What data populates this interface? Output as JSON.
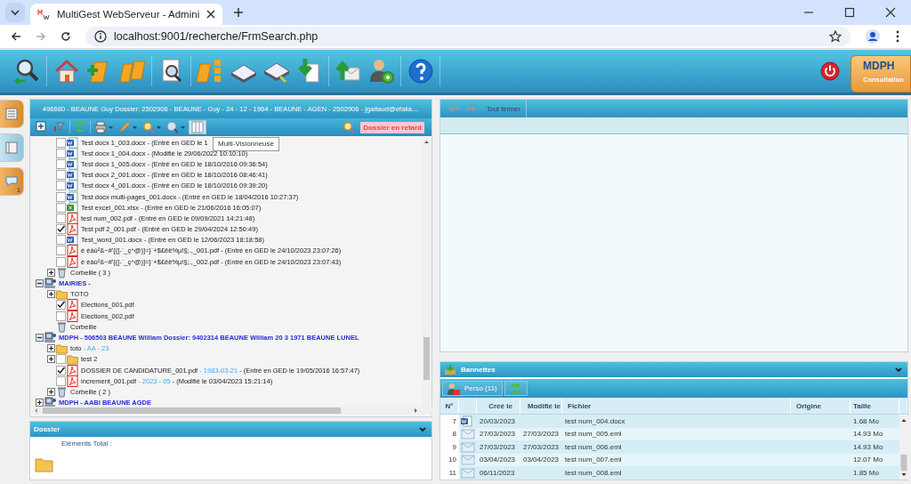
{
  "browser": {
    "tab_title": "MultiGest WebServeur - Admini",
    "url": "localhost:9001/recherche/FrmSearch.php"
  },
  "app_header": {
    "profile": {
      "title": "MDPH",
      "subtitle": "Consultation"
    }
  },
  "side_tabs": [
    {
      "selected": false
    },
    {
      "selected": true
    },
    {
      "selected": false,
      "badge": "1"
    }
  ],
  "dossier_panel": {
    "header": "496680 - BEAUNE Guy Dossier: 2502906 - BEAUNE - Guy - 24 - 12 - 1964 - BEAUNE - AGEN - 2502906 - jgaltaud@efalia....",
    "late_button": "Dossier en retard",
    "tooltip": "Multi-Visionneuse",
    "tree": [
      {
        "children": [
          {
            "kind": "word",
            "label": "Test docx 1_003.docx",
            "info": "- (Entré en GED le 1",
            "checked": false
          },
          {
            "kind": "word",
            "label": "Test docx 1_004.docx",
            "info": "- (Modifié le 29/06/2022 10:10:10)",
            "checked": false
          },
          {
            "kind": "word",
            "label": "Test docx 1_005.docx",
            "info": "- (Entré en GED le 18/10/2016 09:36:54)",
            "checked": false
          },
          {
            "kind": "word",
            "label": "Test docx 2_001.docx",
            "info": "- (Entré en GED le 18/10/2016 08:46:41)",
            "checked": false
          },
          {
            "kind": "word",
            "label": "Test docx 4_001.docx",
            "info": "- (Entré en GED le 18/10/2016 09:39:20)",
            "checked": false
          },
          {
            "kind": "word",
            "label": "Test docx multi-pages_001.docx",
            "info": "- (Entré en GED le 18/04/2016 10:27:37)",
            "checked": false
          },
          {
            "kind": "excel",
            "label": "Test excel_001.xlsx",
            "info": "- (Entré en GED le 21/06/2016 16:05:07)",
            "checked": false
          },
          {
            "kind": "pdf",
            "label": "test num_002.pdf",
            "info": "- (Entré en GED le 09/09/2021 14:21:48)",
            "checked": false
          },
          {
            "kind": "pdf",
            "label": "Test pdf 2_001.pdf",
            "info": "- (Entré en GED le 29/04/2024 12:50:49)",
            "checked": true
          },
          {
            "kind": "word",
            "label": "Test_word_001.docx",
            "info": "- (Entré en GED le 12/06/2023 18:18:58)",
            "checked": false
          },
          {
            "kind": "pdf",
            "label": "é èàù²&~#'{([-`_ç^@)]=}`+$£ëë%µ!§;.,_001.pdf",
            "info": "- (Entré en GED le 24/10/2023 23:07:26)",
            "checked": false
          },
          {
            "kind": "pdf",
            "label": "é èàù²&~#'{([-`_ç^@)]=}`+$£ëë%µ!§;.,_002.pdf",
            "info": "- (Entré en GED le 24/10/2023 23:07:43)",
            "checked": false
          },
          {
            "kind": "trash",
            "label": "Corbeille ( 3 )",
            "expanded": false
          }
        ]
      },
      {
        "kind": "group",
        "label": "MAIRIES -",
        "expanded": true,
        "children": [
          {
            "kind": "folder",
            "label": "TOTO",
            "expanded": false
          },
          {
            "kind": "pdf",
            "label": "Elections_001.pdf",
            "checked": true
          },
          {
            "kind": "pdf",
            "label": "Elections_002.pdf",
            "checked": false
          },
          {
            "kind": "trash",
            "label": "Corbeille"
          }
        ]
      },
      {
        "kind": "group",
        "label": "MDPH - 506503 BEAUNE William Dossier: 9402314 BEAUNE William 20 3 1971 BEAUNE LUNEL",
        "expanded": true,
        "children": [
          {
            "kind": "folder",
            "label": "toto",
            "tag": "- AA - 23",
            "expanded": false
          },
          {
            "kind": "folder",
            "label": "test 2",
            "expanded": false,
            "checked": false
          },
          {
            "kind": "pdf",
            "label": "DOSSIER DE CANDIDATURE_001.pdf",
            "tag": "- 1983-03-21",
            "info": "- (Entré en GED le 19/05/2016 16:57:47)",
            "checked": true
          },
          {
            "kind": "pdf",
            "label": "increment_001.pdf",
            "tag": "- 2023 - 05",
            "info": "- (Modifié le 03/04/2023 15:21:14)",
            "checked": false
          },
          {
            "kind": "trash",
            "label": "Corbeille ( 2 )",
            "expanded": false
          }
        ]
      },
      {
        "kind": "group",
        "label": "MDPH - AABI BEAUNE AGDE",
        "expanded": false
      }
    ]
  },
  "details_panel": {
    "title": "Dossier",
    "total_label": "Eléments Total :"
  },
  "viewer": {
    "close_all": "Tout fermer"
  },
  "bannettes": {
    "title": "Bannettes",
    "perso_button": "Perso (11)",
    "columns": [
      "N°",
      "Créé le",
      "Modifié le",
      "Fichier",
      "Origine",
      "Taille"
    ],
    "rows": [
      {
        "n": "7",
        "kind": "word",
        "created": "20/03/2023",
        "file": "test num_004.docx",
        "size": "1.68 Mo"
      },
      {
        "n": "8",
        "kind": "email",
        "created": "27/03/2023",
        "modified": "27/03/2023",
        "file": "test num_005.eml",
        "size": "14.93 Mo"
      },
      {
        "n": "9",
        "kind": "email",
        "created": "27/03/2023",
        "modified": "27/03/2023",
        "file": "test num_006.eml",
        "size": "14.93 Mo"
      },
      {
        "n": "10",
        "kind": "email",
        "created": "03/04/2023",
        "modified": "03/04/2023",
        "file": "test num_007.eml",
        "size": "12.07 Mo"
      },
      {
        "n": "11",
        "kind": "email",
        "created": "06/11/2023",
        "file": "test num_008.eml",
        "size": "1.85 Mo"
      }
    ]
  }
}
